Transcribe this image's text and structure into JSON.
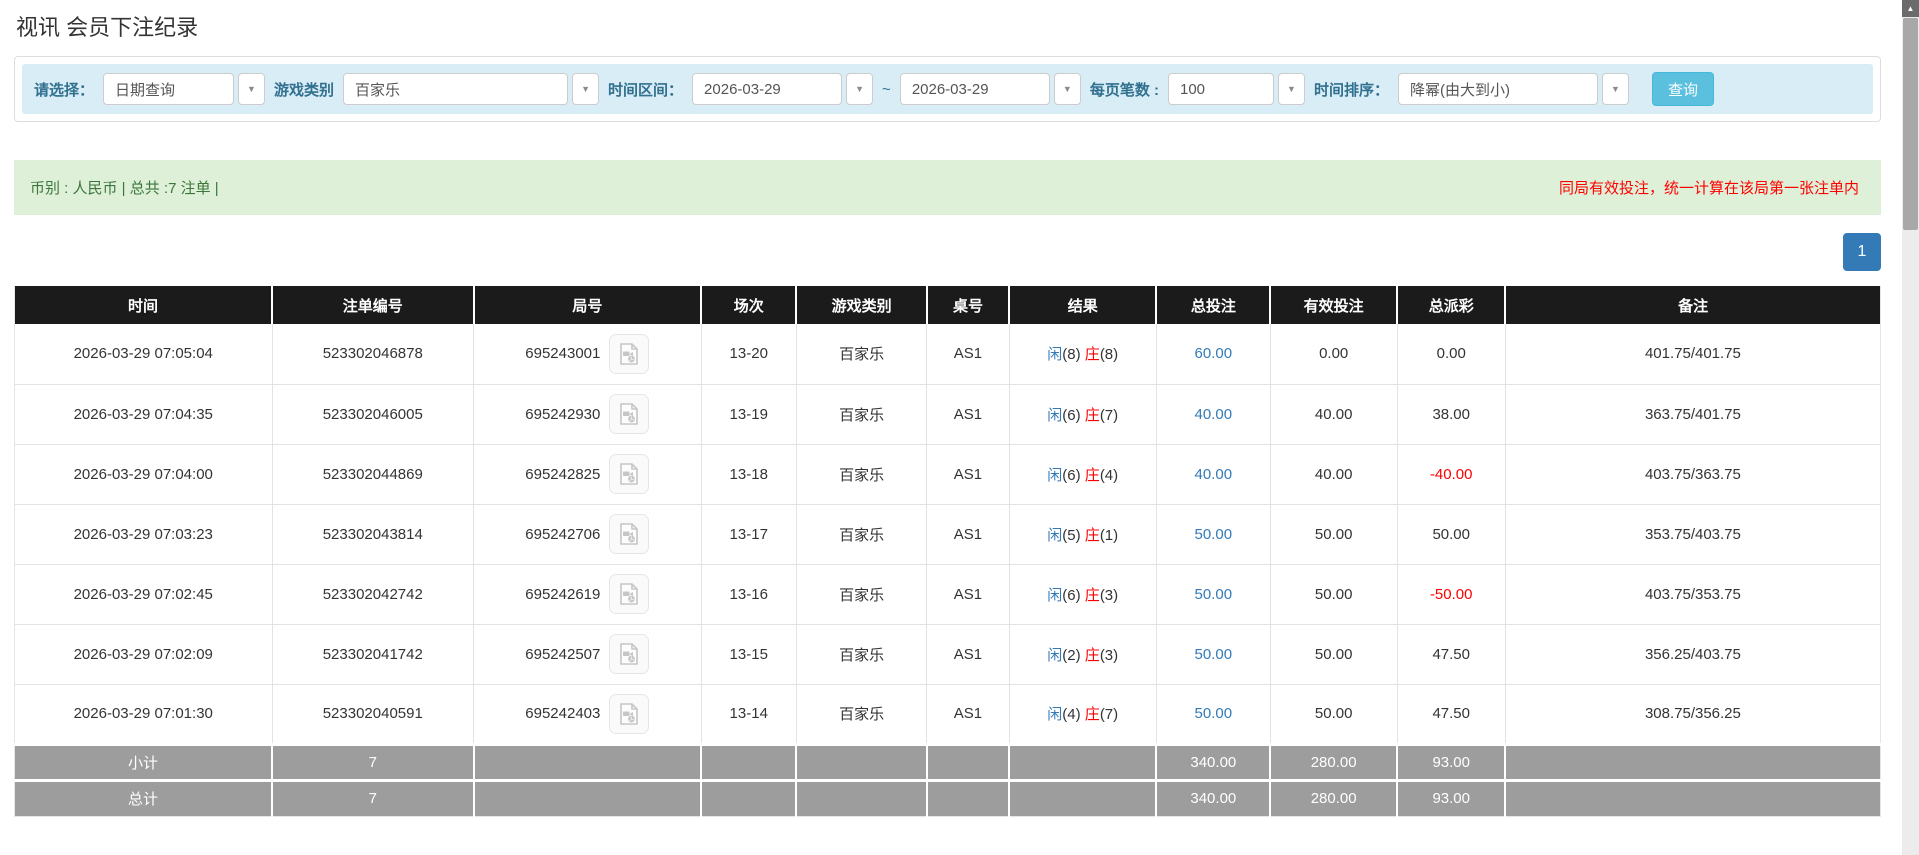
{
  "page": {
    "title": "视讯 会员下注纪录"
  },
  "filters": {
    "select_label": "请选择：",
    "select_value": "日期查询",
    "game_type_label": "游戏类别",
    "game_type_value": "百家乐",
    "date_range_label": "时间区间：",
    "date_from": "2026-03-29",
    "tilde": "~",
    "date_to": "2026-03-29",
    "page_size_label": "每页笔数 :",
    "page_size_value": "100",
    "sort_label": "时间排序：",
    "sort_value": "降幂(由大到小)",
    "search_button_label": "查询"
  },
  "summary": {
    "currency_text": "币别 : 人民币 | 总共 :7 注单 |",
    "notice": "同局有效投注，统一计算在该局第一张注单内"
  },
  "pagination": {
    "page": "1"
  },
  "table": {
    "headers": [
      "时间",
      "注单编号",
      "局号",
      "场次",
      "游戏类别",
      "桌号",
      "结果",
      "总投注",
      "有效投注",
      "总派彩",
      "备注"
    ],
    "rows": [
      {
        "time": "2026-03-29 07:05:04",
        "bet_id": "523302046878",
        "round": "695243001",
        "session": "13-20",
        "game": "百家乐",
        "table_no": "AS1",
        "player_label": "闲",
        "player_score": "(8)",
        "banker_label": "庄",
        "banker_score": "(8)",
        "total_bet": "60.00",
        "valid_bet": "0.00",
        "payout": "0.00",
        "payout_class": "pay",
        "note": "401.75/401.75"
      },
      {
        "time": "2026-03-29 07:04:35",
        "bet_id": "523302046005",
        "round": "695242930",
        "session": "13-19",
        "game": "百家乐",
        "table_no": "AS1",
        "player_label": "闲",
        "player_score": "(6)",
        "banker_label": "庄",
        "banker_score": "(7)",
        "total_bet": "40.00",
        "valid_bet": "40.00",
        "payout": "38.00",
        "payout_class": "pay",
        "note": "363.75/401.75"
      },
      {
        "time": "2026-03-29 07:04:00",
        "bet_id": "523302044869",
        "round": "695242825",
        "session": "13-18",
        "game": "百家乐",
        "table_no": "AS1",
        "player_label": "闲",
        "player_score": "(6)",
        "banker_label": "庄",
        "banker_score": "(4)",
        "total_bet": "40.00",
        "valid_bet": "40.00",
        "payout": "-40.00",
        "payout_class": "pay neg",
        "note": "403.75/363.75"
      },
      {
        "time": "2026-03-29 07:03:23",
        "bet_id": "523302043814",
        "round": "695242706",
        "session": "13-17",
        "game": "百家乐",
        "table_no": "AS1",
        "player_label": "闲",
        "player_score": "(5)",
        "banker_label": "庄",
        "banker_score": "(1)",
        "total_bet": "50.00",
        "valid_bet": "50.00",
        "payout": "50.00",
        "payout_class": "pay",
        "note": "353.75/403.75"
      },
      {
        "time": "2026-03-29 07:02:45",
        "bet_id": "523302042742",
        "round": "695242619",
        "session": "13-16",
        "game": "百家乐",
        "table_no": "AS1",
        "player_label": "闲",
        "player_score": "(6)",
        "banker_label": "庄",
        "banker_score": "(3)",
        "total_bet": "50.00",
        "valid_bet": "50.00",
        "payout": "-50.00",
        "payout_class": "pay neg",
        "note": "403.75/353.75"
      },
      {
        "time": "2026-03-29 07:02:09",
        "bet_id": "523302041742",
        "round": "695242507",
        "session": "13-15",
        "game": "百家乐",
        "table_no": "AS1",
        "player_label": "闲",
        "player_score": "(2)",
        "banker_label": "庄",
        "banker_score": "(3)",
        "total_bet": "50.00",
        "valid_bet": "50.00",
        "payout": "47.50",
        "payout_class": "pay",
        "note": "356.25/403.75"
      },
      {
        "time": "2026-03-29 07:01:30",
        "bet_id": "523302040591",
        "round": "695242403",
        "session": "13-14",
        "game": "百家乐",
        "table_no": "AS1",
        "player_label": "闲",
        "player_score": "(4)",
        "banker_label": "庄",
        "banker_score": "(7)",
        "total_bet": "50.00",
        "valid_bet": "50.00",
        "payout": "47.50",
        "payout_class": "pay",
        "note": "308.75/356.25"
      }
    ],
    "footer": [
      {
        "label": "小计",
        "count": "7",
        "total_bet": "340.00",
        "valid_bet": "280.00",
        "payout": "93.00"
      },
      {
        "label": "总计",
        "count": "7",
        "total_bet": "340.00",
        "valid_bet": "280.00",
        "payout": "93.00"
      }
    ]
  },
  "colors": {
    "accent_blue": "#337ab7",
    "banker_red": "#ff0000",
    "search_button": "#5bc0de",
    "filter_bar_bg": "#d9edf7",
    "summary_bg": "#dff0d8",
    "summary_text": "#3c763d",
    "table_header_bg": "#1b1b1b",
    "table_footer_bg": "#9d9d9d"
  }
}
